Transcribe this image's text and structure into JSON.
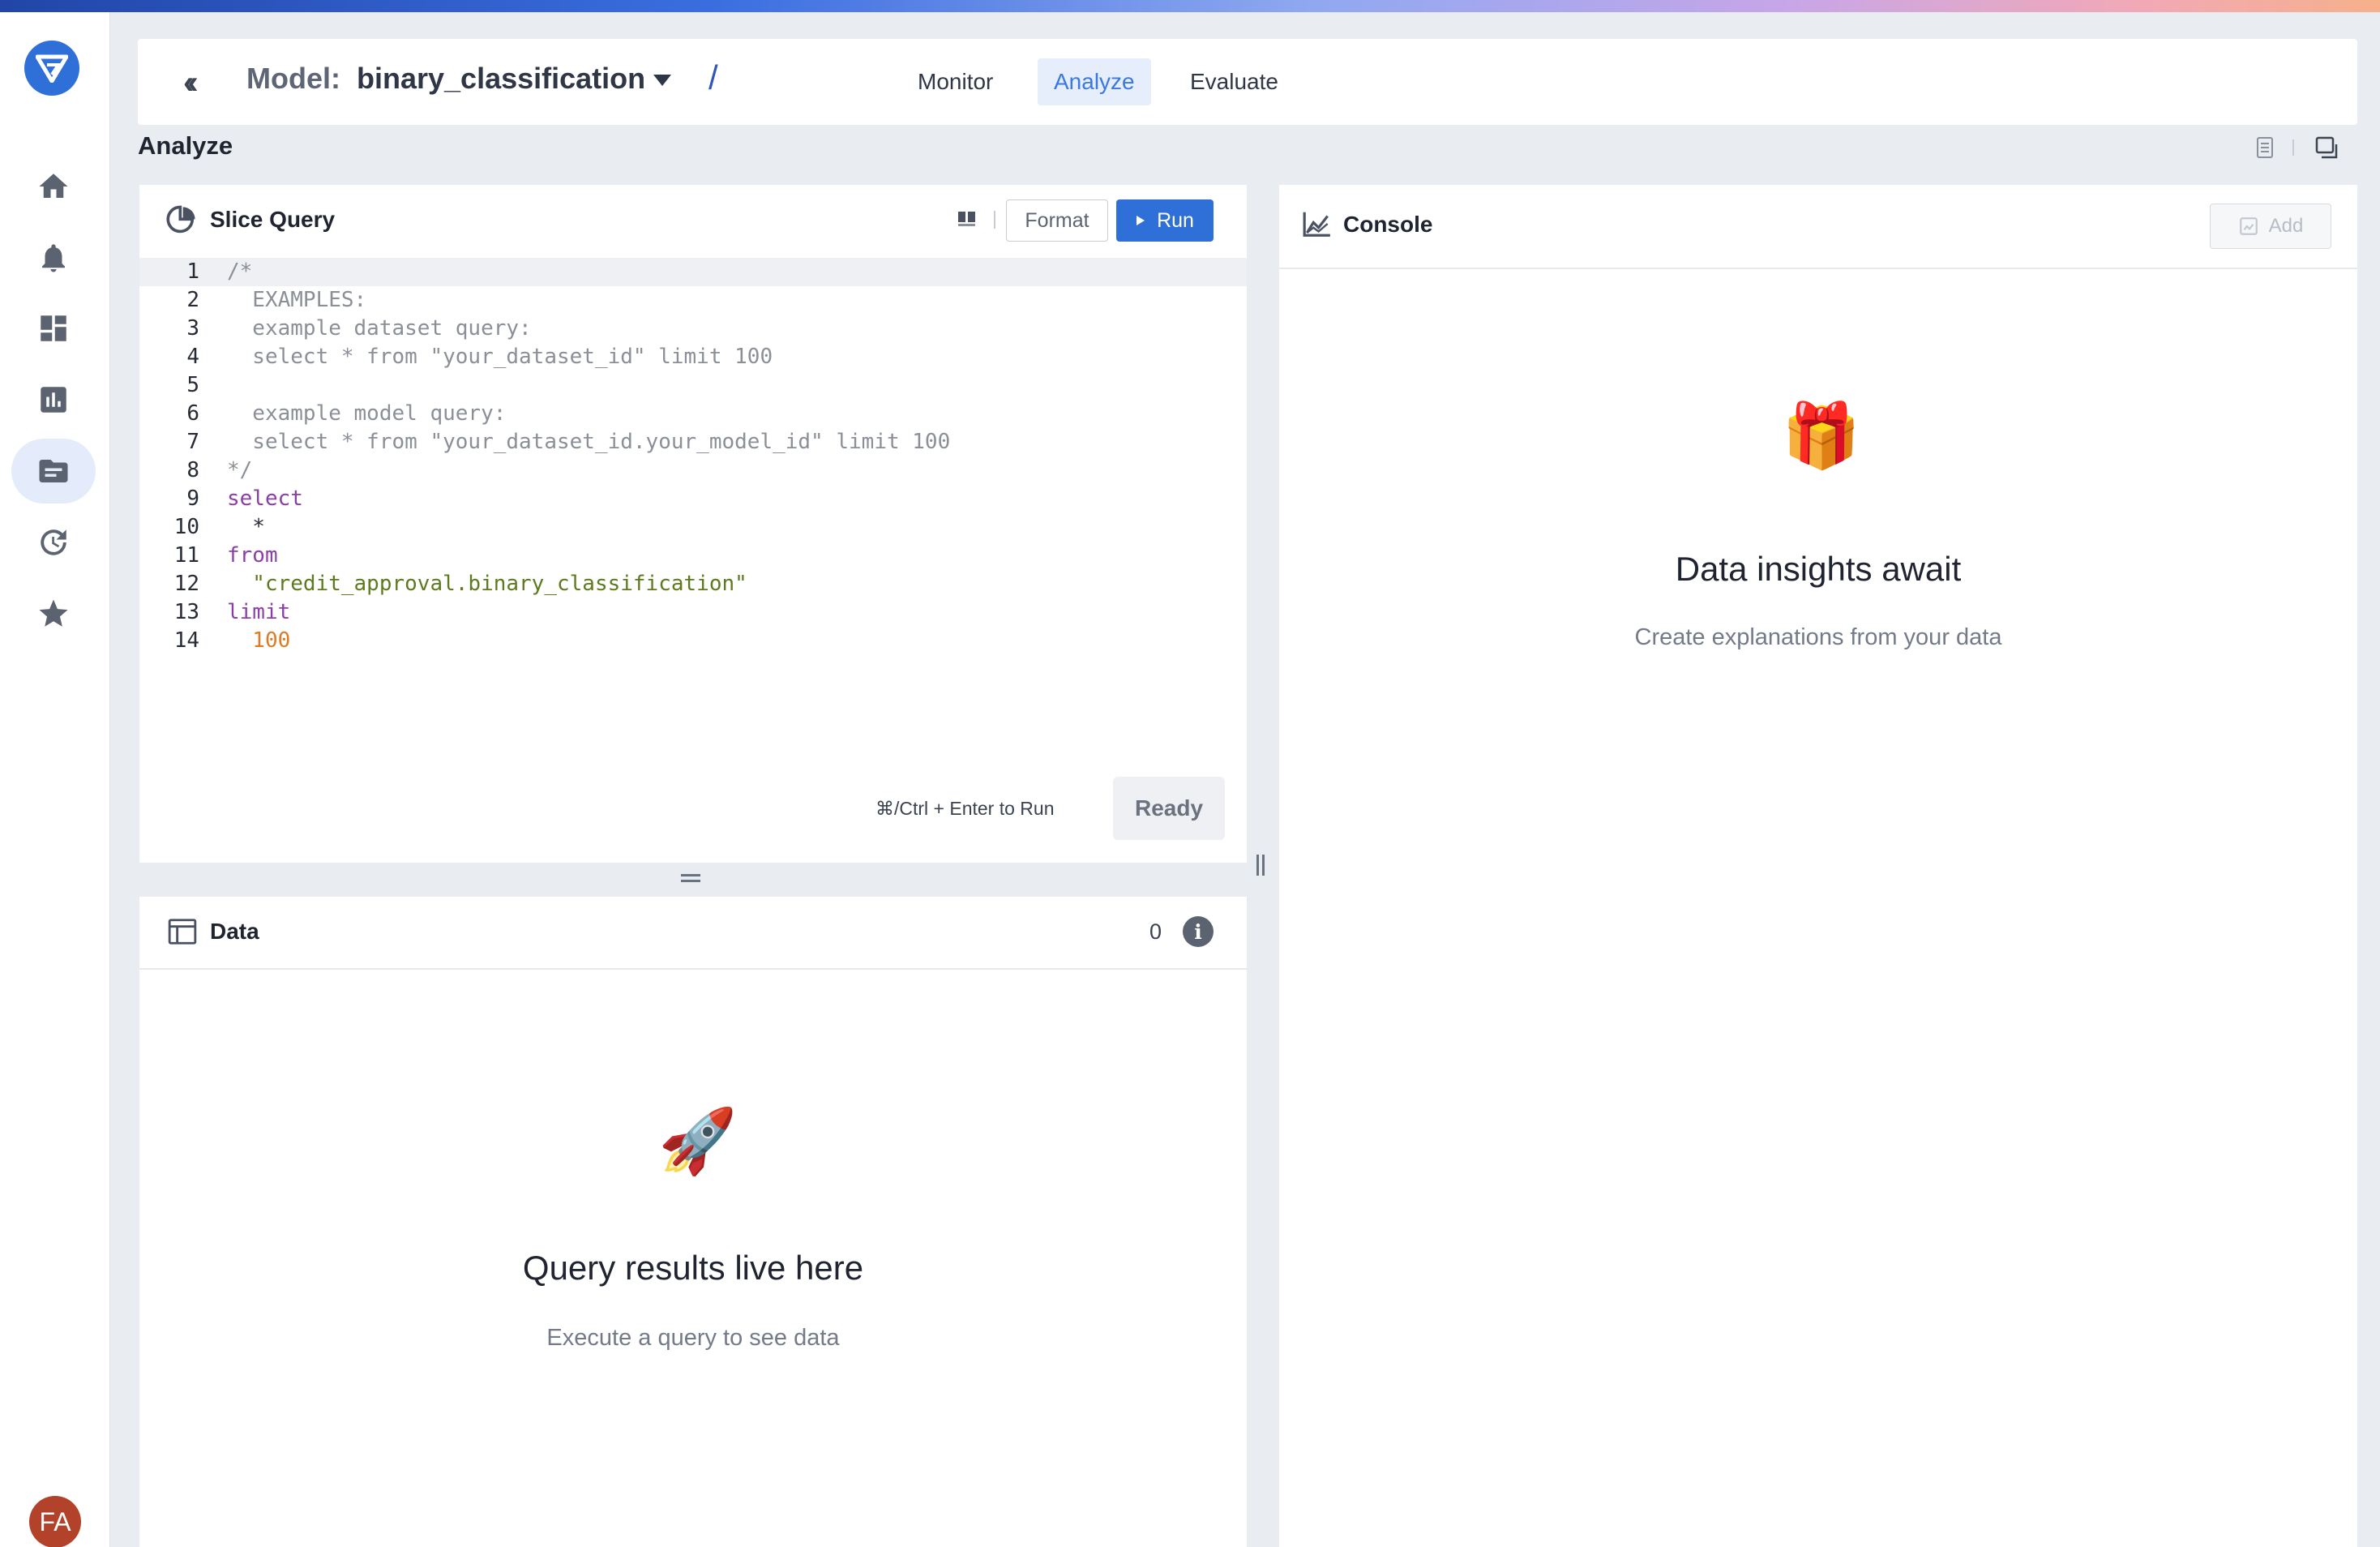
{
  "brand": {
    "accent": "#2f6fd8",
    "logo_icon": "fiddler-logo-icon"
  },
  "sidebar": {
    "items": [
      {
        "icon": "home-icon"
      },
      {
        "icon": "bell-icon"
      },
      {
        "icon": "dashboard-icon"
      },
      {
        "icon": "bar-chart-icon"
      },
      {
        "icon": "folder-icon",
        "active": true
      },
      {
        "icon": "history-icon"
      },
      {
        "icon": "star-icon"
      }
    ],
    "avatar_initials": "FA"
  },
  "header": {
    "back_icon": "double-chevron-left-icon",
    "model_label": "Model:",
    "model_name": "binary_classification",
    "separator": "/",
    "tabs": [
      {
        "label": "Monitor",
        "active": false
      },
      {
        "label": "Analyze",
        "active": true
      },
      {
        "label": "Evaluate",
        "active": false
      }
    ]
  },
  "page": {
    "title": "Analyze"
  },
  "slice_query": {
    "title": "Slice Query",
    "format_label": "Format",
    "run_label": "Run",
    "shortcut_hint": "⌘/Ctrl + Enter to Run",
    "status": "Ready",
    "lines": [
      {
        "n": "1",
        "text": "/*"
      },
      {
        "n": "2",
        "text": "  EXAMPLES:"
      },
      {
        "n": "3",
        "text": "  example dataset query:"
      },
      {
        "n": "4",
        "text": "  select * from \"your_dataset_id\" limit 100"
      },
      {
        "n": "5",
        "text": ""
      },
      {
        "n": "6",
        "text": "  example model query:"
      },
      {
        "n": "7",
        "text": "  select * from \"your_dataset_id.your_model_id\" limit 100"
      },
      {
        "n": "8",
        "text": "*/"
      },
      {
        "n": "9",
        "text": "select"
      },
      {
        "n": "10",
        "text": "  *"
      },
      {
        "n": "11",
        "text": "from"
      },
      {
        "n": "12",
        "text": "  \"credit_approval.binary_classification\""
      },
      {
        "n": "13",
        "text": "limit"
      },
      {
        "n": "14",
        "text": "  100"
      }
    ]
  },
  "data_panel": {
    "title": "Data",
    "count": "0",
    "info_icon": "i",
    "empty_emoji": "🚀",
    "empty_title": "Query results live here",
    "empty_subtitle": "Execute a query to see data"
  },
  "console": {
    "title": "Console",
    "add_label": "Add",
    "empty_emoji": "🎁",
    "empty_title": "Data insights await",
    "empty_subtitle": "Create explanations from your data"
  }
}
